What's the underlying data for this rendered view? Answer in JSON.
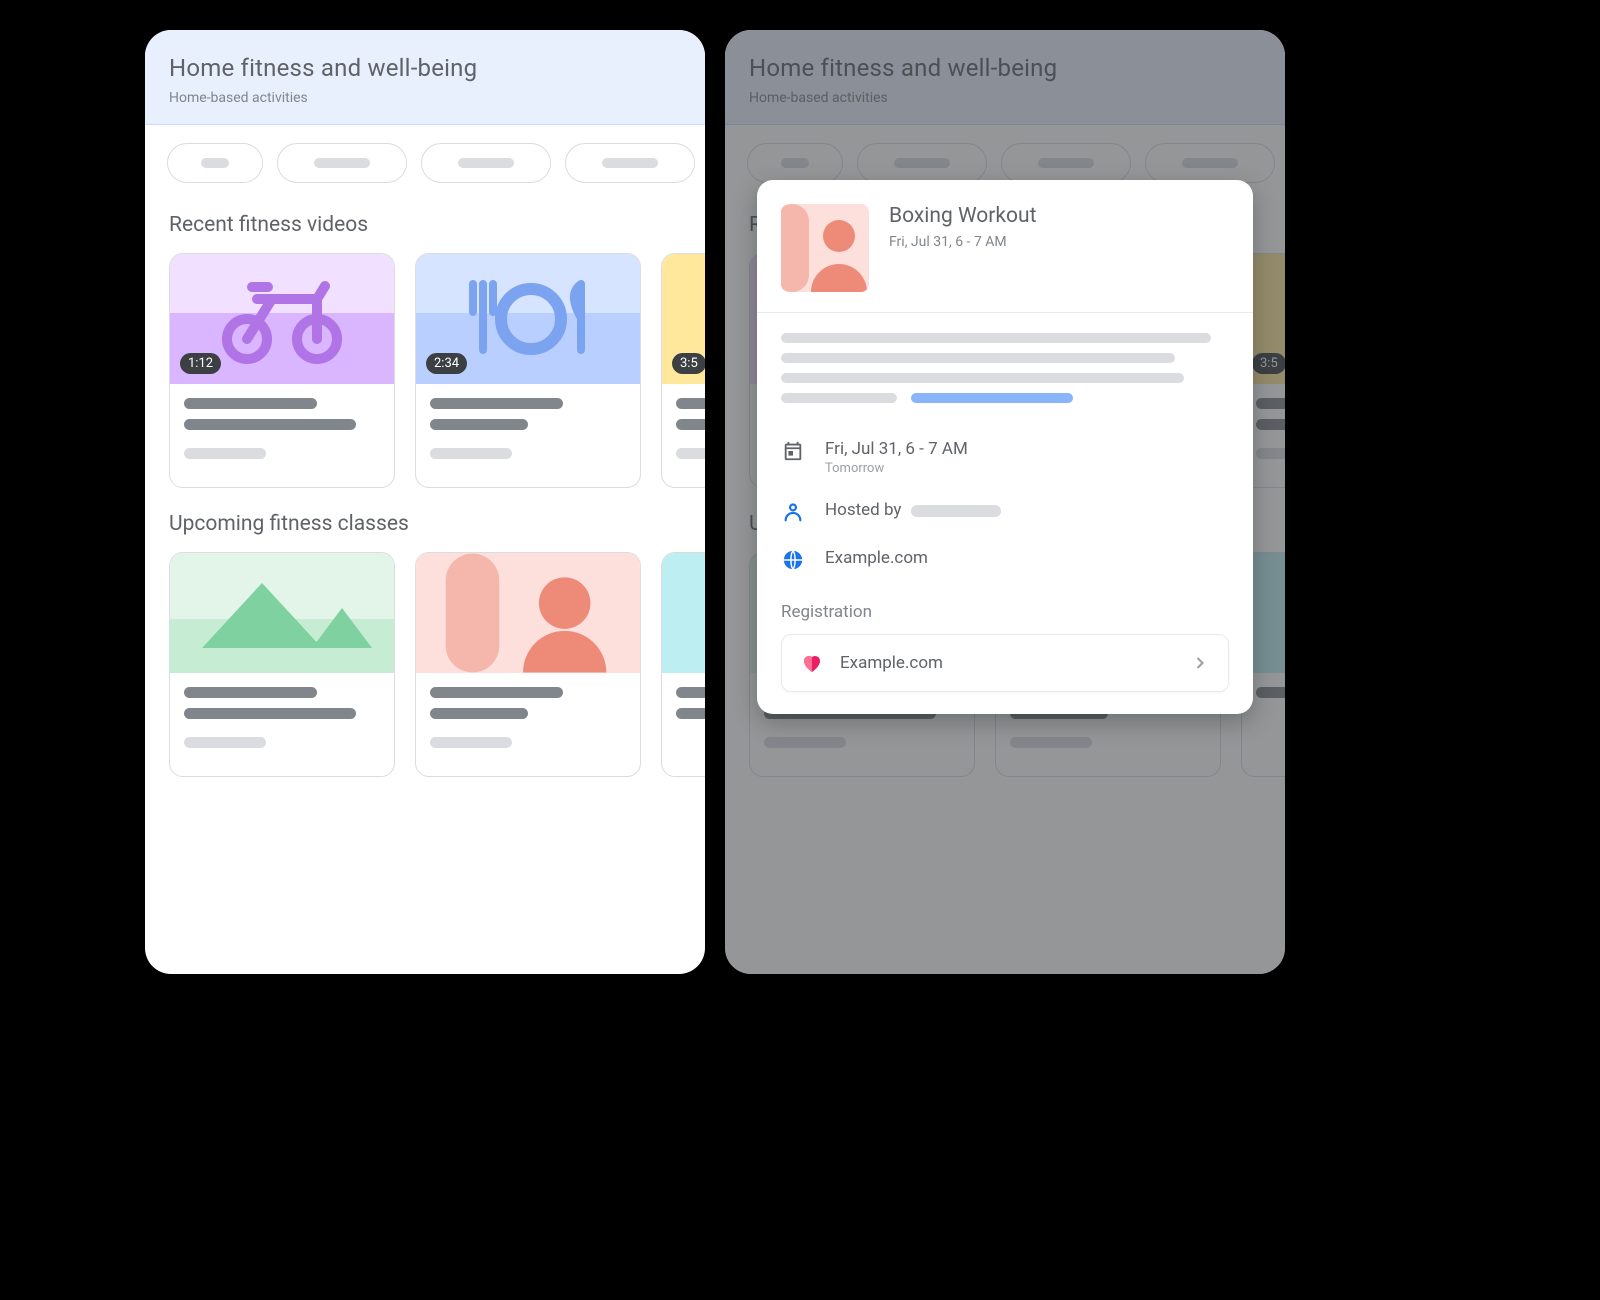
{
  "header": {
    "title": "Home fitness and well-being",
    "subtitle": "Home-based activities"
  },
  "sections": {
    "recent": "Recent fitness videos",
    "upcoming": "Upcoming fitness classes"
  },
  "videos": [
    {
      "duration": "1:12",
      "thumb": "bike",
      "color": "#e9d1ff"
    },
    {
      "duration": "2:34",
      "thumb": "meal",
      "color": "#c7dbff"
    },
    {
      "duration": "3:5",
      "thumb": "plain",
      "color": "#ffe79b"
    }
  ],
  "classes": [
    {
      "thumb": "hills",
      "color": "#c6ecd3"
    },
    {
      "thumb": "person",
      "color": "#fde0db"
    },
    {
      "thumb": "plain",
      "color": "#bdeef2"
    }
  ],
  "modal": {
    "title": "Boxing Workout",
    "when": "Fri, Jul 31, 6 - 7 AM",
    "detail_when": "Fri, Jul 31, 6 - 7 AM",
    "detail_when_rel": "Tomorrow",
    "hosted_by_label": "Hosted by",
    "site": "Example.com",
    "registration_label": "Registration",
    "registration_site": "Example.com"
  }
}
